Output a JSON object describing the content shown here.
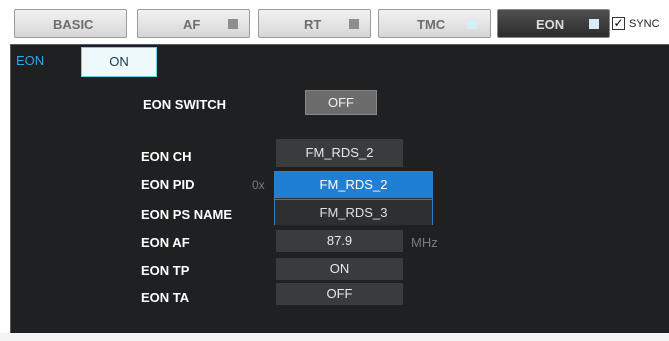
{
  "tabs": [
    {
      "label": "BASIC"
    },
    {
      "label": "AF"
    },
    {
      "label": "RT"
    },
    {
      "label": "TMC"
    },
    {
      "label": "EON"
    }
  ],
  "sync": {
    "label": "SYNC",
    "checked": true
  },
  "panel": {
    "section_label": "EON",
    "on_button": "ON",
    "switch": {
      "label": "EON SWITCH",
      "value": "OFF"
    },
    "fields": {
      "ch": {
        "label": "EON CH",
        "value": "FM_RDS_2"
      },
      "pid": {
        "label": "EON PID",
        "prefix": "0x"
      },
      "ps_name": {
        "label": "EON PS NAME"
      },
      "af": {
        "label": "EON AF",
        "value": "87.9",
        "unit": "MHz"
      },
      "tp": {
        "label": "EON TP",
        "value": "ON"
      },
      "ta": {
        "label": "EON TA",
        "value": "OFF"
      }
    },
    "dropdown_options": [
      "FM_RDS_2",
      "FM_RDS_3"
    ]
  },
  "colors": {
    "accent": "#2aa8e6",
    "panel_bg": "#1f2022",
    "selected": "#1f7fd4"
  }
}
